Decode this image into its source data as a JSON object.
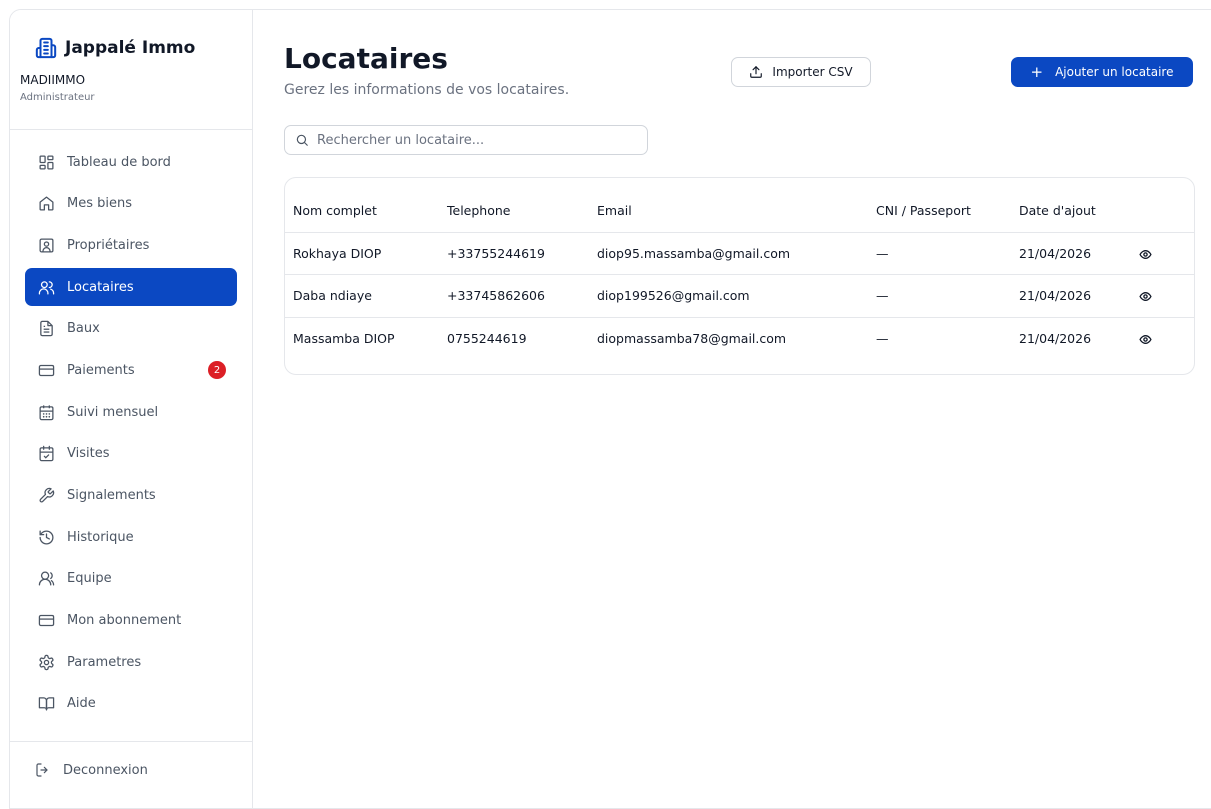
{
  "sidebar": {
    "brand": "Jappalé Immo",
    "org_name": "MADIIMMO",
    "org_role": "Administrateur",
    "items": [
      {
        "label": "Tableau de bord",
        "icon": "dashboard-icon"
      },
      {
        "label": "Mes biens",
        "icon": "home-icon"
      },
      {
        "label": "Propriétaires",
        "icon": "contact-card-icon"
      },
      {
        "label": "Locataires",
        "icon": "users-icon",
        "active": true
      },
      {
        "label": "Baux",
        "icon": "file-text-icon"
      },
      {
        "label": "Paiements",
        "icon": "credit-card-icon",
        "badge": "2"
      },
      {
        "label": "Suivi mensuel",
        "icon": "calendar-grid-icon"
      },
      {
        "label": "Visites",
        "icon": "calendar-check-icon"
      },
      {
        "label": "Signalements",
        "icon": "wrench-icon"
      },
      {
        "label": "Historique",
        "icon": "history-icon"
      },
      {
        "label": "Equipe",
        "icon": "team-icon"
      },
      {
        "label": "Mon abonnement",
        "icon": "credit-card-icon"
      },
      {
        "label": "Parametres",
        "icon": "gear-icon"
      },
      {
        "label": "Aide",
        "icon": "book-icon"
      }
    ],
    "logout_label": "Deconnexion"
  },
  "header": {
    "title": "Locataires",
    "subtitle": "Gerez les informations de vos locataires.",
    "import_label": "Importer CSV",
    "add_label": "Ajouter un locataire"
  },
  "search": {
    "placeholder": "Rechercher un locataire..."
  },
  "table": {
    "columns": [
      "Nom complet",
      "Telephone",
      "Email",
      "CNI / Passeport",
      "Date d'ajout"
    ],
    "rows": [
      {
        "name": "Rokhaya DIOP",
        "phone": "+33755244619",
        "email": "diop95.massamba@gmail.com",
        "cni": "—",
        "date": "21/04/2026"
      },
      {
        "name": "Daba ndiaye",
        "phone": "+33745862606",
        "email": "diop199526@gmail.com",
        "cni": "—",
        "date": "21/04/2026"
      },
      {
        "name": "Massamba DIOP",
        "phone": "0755244619",
        "email": "diopmassamba78@gmail.com",
        "cni": "—",
        "date": "21/04/2026"
      }
    ]
  },
  "colors": {
    "accent": "#0b48c2",
    "badge": "#dc1f26",
    "border": "#e5e7eb",
    "muted_text": "#6b7280"
  }
}
